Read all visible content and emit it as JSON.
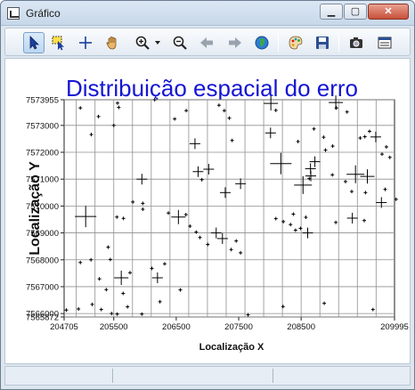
{
  "window": {
    "title": "Gráfico"
  },
  "window_controls": {
    "minimize": "▁",
    "maximize": "▢",
    "close": "✕"
  },
  "toolbar": {
    "buttons": [
      {
        "name": "select-arrow-icon",
        "active": true
      },
      {
        "name": "select-region-icon",
        "active": false
      },
      {
        "name": "crosshair-icon",
        "active": false
      },
      {
        "name": "pan-hand-icon",
        "active": false
      },
      {
        "name": "zoom-in-icon",
        "active": false
      },
      {
        "name": "zoom-dropdown-icon",
        "active": false
      },
      {
        "name": "zoom-out-icon",
        "active": false
      },
      {
        "name": "back-arrow-icon",
        "active": false
      },
      {
        "name": "forward-arrow-icon",
        "active": false
      },
      {
        "name": "globe-icon",
        "active": false
      },
      {
        "name": "palette-icon",
        "active": false
      },
      {
        "name": "save-disk-icon",
        "active": false
      },
      {
        "name": "camera-icon",
        "active": false
      },
      {
        "name": "properties-icon",
        "active": false
      }
    ]
  },
  "chart_data": {
    "type": "scatter",
    "title": "Distribuição espacial do erro",
    "xlabel": "Localização X",
    "ylabel": "Localização Y",
    "xlim": [
      204705,
      209995
    ],
    "ylim": [
      7565872,
      7573955
    ],
    "xticks": [
      204705,
      205500,
      206500,
      207500,
      208500,
      209995
    ],
    "xtick_labels": [
      "204705",
      "205500",
      "206500",
      "207500",
      "208500",
      "209995"
    ],
    "yticks": [
      7565872,
      7566000,
      7567000,
      7568000,
      7569000,
      7570000,
      7571000,
      7572000,
      7573000,
      7573955
    ],
    "ytick_labels": [
      "7565872",
      "7566000",
      "7567000",
      "7568000",
      "7569000",
      "7570000",
      "7571000",
      "7572000",
      "7573000",
      "7573955"
    ],
    "grid": true,
    "title_color": "#1515d4",
    "marker": "plus",
    "points": [
      [
        204965,
        7573650,
        2
      ],
      [
        205255,
        7573330,
        2
      ],
      [
        205500,
        7573000,
        2
      ],
      [
        205560,
        7573830,
        2
      ],
      [
        205580,
        7573670,
        2
      ],
      [
        205140,
        7572660,
        2
      ],
      [
        206155,
        7573955,
        2
      ],
      [
        206475,
        7573240,
        2
      ],
      [
        206660,
        7573550,
        2
      ],
      [
        207185,
        7573750,
        2
      ],
      [
        207270,
        7573550,
        2
      ],
      [
        207350,
        7573270,
        2
      ],
      [
        208015,
        7573820,
        8
      ],
      [
        208095,
        7573560,
        2
      ],
      [
        208705,
        7572870,
        2
      ],
      [
        209055,
        7573850,
        8
      ],
      [
        209065,
        7573650,
        2
      ],
      [
        209235,
        7573500,
        2
      ],
      [
        209445,
        7572530,
        2
      ],
      [
        209520,
        7572580,
        2
      ],
      [
        206800,
        7572320,
        6
      ],
      [
        207395,
        7572440,
        2
      ],
      [
        208010,
        7572720,
        6
      ],
      [
        208450,
        7572400,
        2
      ],
      [
        208860,
        7572560,
        2
      ],
      [
        209005,
        7572230,
        2
      ],
      [
        208890,
        7572080,
        2
      ],
      [
        209695,
        7572570,
        6
      ],
      [
        209595,
        7572780,
        2
      ],
      [
        209865,
        7572200,
        2
      ],
      [
        209795,
        7571930,
        2
      ],
      [
        209920,
        7571810,
        2
      ],
      [
        206850,
        7571280,
        6
      ],
      [
        207020,
        7571370,
        6
      ],
      [
        208175,
        7571580,
        12
      ],
      [
        208720,
        7571650,
        6
      ],
      [
        208650,
        7571390,
        6
      ],
      [
        209370,
        7571180,
        10
      ],
      [
        209560,
        7571100,
        8
      ],
      [
        206910,
        7570980,
        2
      ],
      [
        209000,
        7571160,
        2
      ],
      [
        205950,
        7571000,
        6
      ],
      [
        207285,
        7570500,
        6
      ],
      [
        207530,
        7570830,
        6
      ],
      [
        208630,
        7571020,
        2
      ],
      [
        208530,
        7570780,
        10
      ],
      [
        208655,
        7571120,
        6
      ],
      [
        209210,
        7570910,
        2
      ],
      [
        209310,
        7570540,
        2
      ],
      [
        209845,
        7570620,
        2
      ],
      [
        209530,
        7570500,
        2
      ],
      [
        205805,
        7570150,
        2
      ],
      [
        205965,
        7570100,
        2
      ],
      [
        206375,
        7569740,
        2
      ],
      [
        206655,
        7569680,
        2
      ],
      [
        205965,
        7569880,
        2
      ],
      [
        205655,
        7569540,
        2
      ],
      [
        205050,
        7569610,
        12
      ],
      [
        205550,
        7569590,
        2
      ],
      [
        206535,
        7569590,
        8
      ],
      [
        208095,
        7569530,
        2
      ],
      [
        208375,
        7569700,
        2
      ],
      [
        208575,
        7569580,
        2
      ],
      [
        209320,
        7569550,
        6
      ],
      [
        209785,
        7570130,
        6
      ],
      [
        206720,
        7569250,
        2
      ],
      [
        206820,
        7569030,
        2
      ],
      [
        206880,
        7568830,
        2
      ],
      [
        207005,
        7568570,
        2
      ],
      [
        207140,
        7569000,
        6
      ],
      [
        207240,
        7568790,
        6
      ],
      [
        207460,
        7568700,
        2
      ],
      [
        207380,
        7568380,
        2
      ],
      [
        207530,
        7568260,
        2
      ],
      [
        208215,
        7569420,
        2
      ],
      [
        208330,
        7569310,
        2
      ],
      [
        208410,
        7569100,
        2
      ],
      [
        208490,
        7569170,
        2
      ],
      [
        208605,
        7569000,
        6
      ],
      [
        209055,
        7569390,
        2
      ],
      [
        209510,
        7569460,
        2
      ],
      [
        210020,
        7570250,
        2
      ],
      [
        205410,
        7568470,
        2
      ],
      [
        205445,
        7568010,
        2
      ],
      [
        205760,
        7567520,
        2
      ],
      [
        205620,
        7567330,
        8
      ],
      [
        206110,
        7567680,
        2
      ],
      [
        206315,
        7567850,
        2
      ],
      [
        206200,
        7567330,
        6
      ],
      [
        206565,
        7566880,
        2
      ],
      [
        204965,
        7567900,
        2
      ],
      [
        205135,
        7568000,
        2
      ],
      [
        205270,
        7567290,
        2
      ],
      [
        205380,
        7566890,
        2
      ],
      [
        205650,
        7566750,
        2
      ],
      [
        205300,
        7566150,
        2
      ],
      [
        205465,
        7566000,
        2
      ],
      [
        205555,
        7565980,
        2
      ],
      [
        205155,
        7566340,
        2
      ],
      [
        204935,
        7566170,
        2
      ],
      [
        204740,
        7566130,
        2
      ],
      [
        205720,
        7566250,
        2
      ],
      [
        205950,
        7565980,
        2
      ],
      [
        206240,
        7566440,
        2
      ],
      [
        207650,
        7565950,
        2
      ],
      [
        208210,
        7566260,
        2
      ],
      [
        208870,
        7566380,
        2
      ],
      [
        209650,
        7566150,
        2
      ]
    ]
  }
}
